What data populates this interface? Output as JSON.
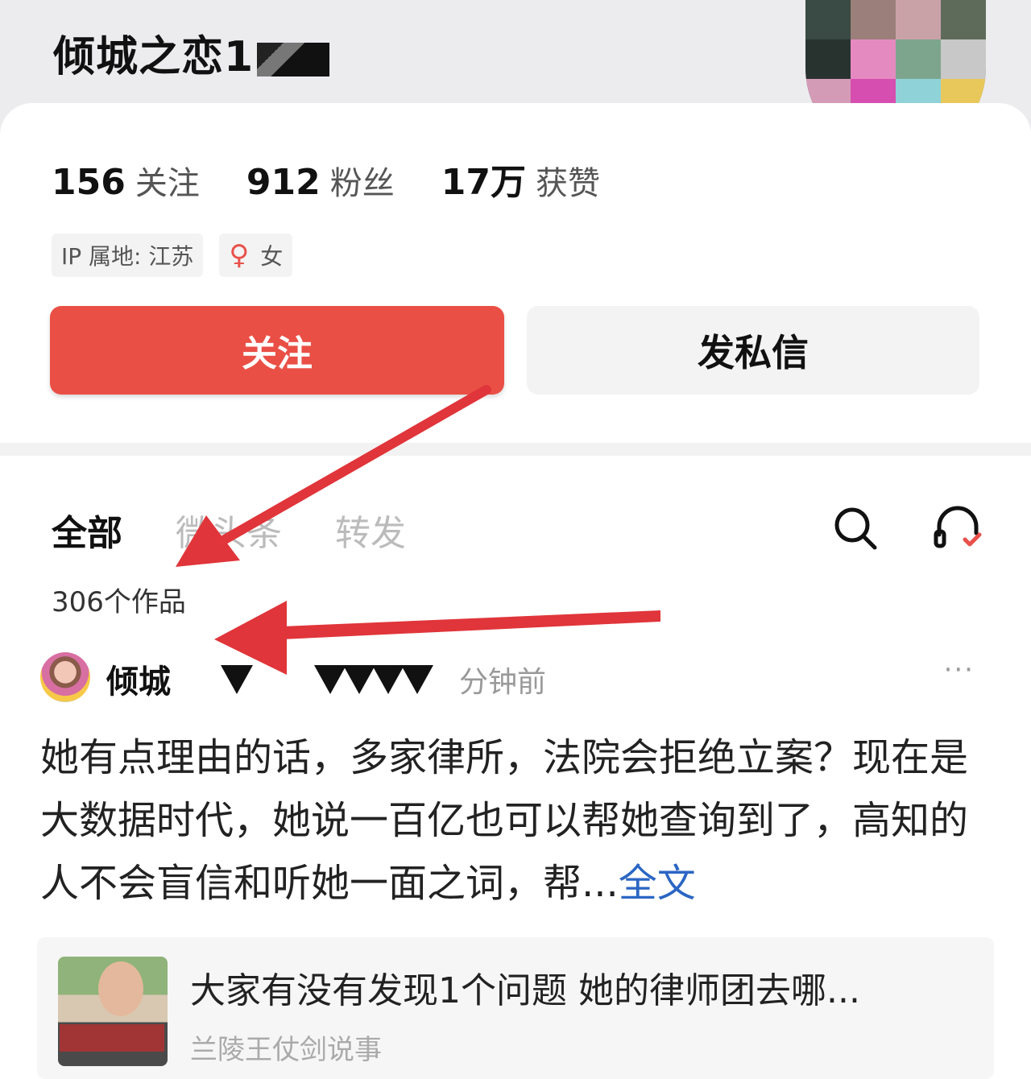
{
  "profile": {
    "username": "倾城之恋1",
    "stats": [
      {
        "value": "156",
        "label": "关注"
      },
      {
        "value": "912",
        "label": "粉丝"
      },
      {
        "value": "17万",
        "label": "获赞"
      }
    ],
    "tags": {
      "ip_location": "IP 属地: 江苏",
      "gender_symbol": "♀",
      "gender": "女"
    },
    "follow_button": "关注",
    "message_button": "发私信"
  },
  "tabs": [
    {
      "label": "全部"
    },
    {
      "label": "微头条"
    },
    {
      "label": "转发"
    }
  ],
  "works_count": "306个作品",
  "post": {
    "author": "倾城",
    "time": "分钟前",
    "more": "···",
    "text": "她有点理由的话，多家律所，法院会拒绝立案？现在是大数据时代，她说一百亿也可以帮她查询到了，高知的人不会盲信和听她一面之词，帮...",
    "full_link": "全文"
  },
  "quote": {
    "title": "大家有没有发现1个问题 她的律师团去哪...",
    "source": "兰陵王仗剑说事"
  },
  "colors": {
    "accent": "#ea4f45",
    "link": "#2b66c4",
    "arrow": "#e0353a"
  },
  "icons": [
    "search-icon",
    "headset-icon",
    "more-icon",
    "female-icon"
  ]
}
